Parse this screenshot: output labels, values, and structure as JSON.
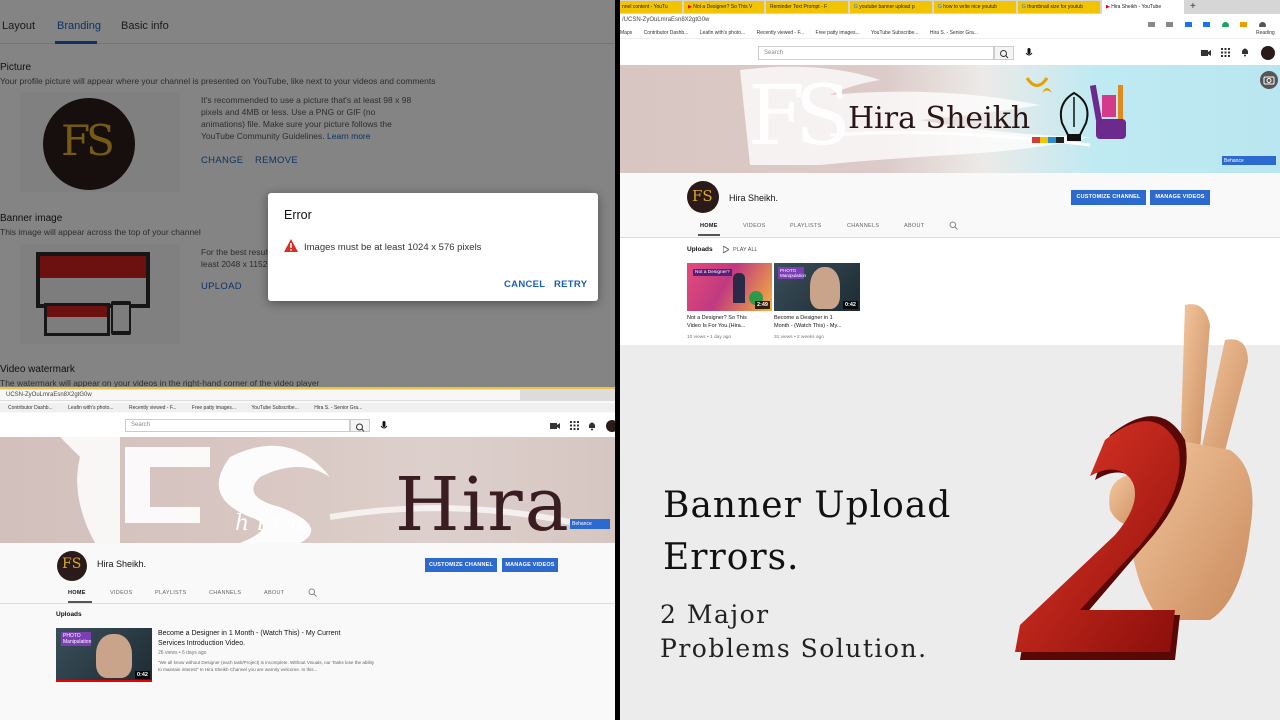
{
  "studio": {
    "tabs": [
      "Layout",
      "Branding",
      "Basic info"
    ],
    "picture": {
      "heading": "Picture",
      "subtitle": "Your profile picture will appear where your channel is presented on YouTube, like next to your videos and comments",
      "desc_line1": "It's recommended to use a picture that's at least 98 x 98",
      "desc_line2": "pixels and 4MB or less. Use a PNG or GIF (no",
      "desc_line3": "animations) file. Make sure your picture follows the",
      "desc_line4": "YouTube Community Guidelines.",
      "learn_more": "Learn more",
      "change": "CHANGE",
      "remove": "REMOVE"
    },
    "banner": {
      "heading": "Banner image",
      "subtitle": "This image will appear across the top of your channel",
      "desc_line1": "For the best results",
      "desc_line2": "least 2048 x 1152",
      "upload": "UPLOAD"
    },
    "watermark": {
      "heading": "Video watermark",
      "subtitle": "The watermark will appear on your videos in the right-hand corner of the video player"
    },
    "error": {
      "title": "Error",
      "message": "Images must be at least 1024 x 576 pixels",
      "cancel": "CANCEL",
      "retry": "RETRY"
    }
  },
  "browser_right": {
    "tabs": [
      "nnel content - YouTu",
      "Not a Designer? So This V",
      "Reminder Text Prompt - F",
      "youtube banner upload p",
      "how to write nice youtub",
      "thumbnail size for youtub",
      "Hira Sheikh - YouTube"
    ],
    "new_tab": "+",
    "address": "/UCSN-ZyOuLmraEsn8X2gtG0w",
    "bookmarks": [
      "Maps",
      "Contributor Dashb...",
      "Leafin with's photo...",
      "Recently viewed - F...",
      "Free patty images...",
      "YouTube Subscribe...",
      "Hira S. - Senior Gra..."
    ],
    "reading": "Reading"
  },
  "browser_left": {
    "address": "UCSN-ZyOuLmraEsn8X2gtG0w",
    "bookmarks": [
      "Contributor Dashb...",
      "Leafin with's photo...",
      "Recently viewed - F...",
      "Free patty images...",
      "YouTube Subscribe...",
      "Hira S. - Senior Gra..."
    ]
  },
  "channel": {
    "search_placeholder": "Search",
    "name": "Hira Sheikh.",
    "banner_name": "Hira Sheikh",
    "banner_name_zoomed": "Hira",
    "banner_script": "hira",
    "behance": "Behance",
    "customize": "CUSTOMIZE CHANNEL",
    "manage": "MANAGE VIDEOS",
    "nav": [
      "HOME",
      "VIDEOS",
      "PLAYLISTS",
      "CHANNELS",
      "ABOUT"
    ],
    "uploads_label": "Uploads",
    "play_all": "PLAY ALL",
    "videos": [
      {
        "title_l1": "Not a Designer? So This",
        "title_l2": "Video Is For You.(Hira...",
        "meta": "10 views • 1 day ago",
        "duration": "2:49"
      },
      {
        "title_l1": "Become a Designer in 1",
        "title_l2": "Month - (Watch This) - My...",
        "meta": "31 views • 2 weeks ago",
        "duration": "0:42"
      }
    ],
    "list_video": {
      "title_l1": "Become a Designer in 1 Month - (Watch This) - My Current",
      "title_l2": "Services Introduction Video.",
      "meta": "26 views • 6 days ago",
      "desc_l1": "\"We all know without Designer (each task/Project) is incomplete. Without Visuals, our Tasks lose the ability",
      "desc_l2": "to maintain interest\" In Hira Sheikh Channel you are warmly welcome. In this...",
      "duration": "0:42"
    },
    "thumb_label_1": "Not a Designer?",
    "thumb_label_2": "PHOTO Manipulation"
  },
  "overlay": {
    "title_line1": "Banner Upload",
    "title_line2": "Errors.",
    "subtitle_line1": "2 Major",
    "subtitle_line2": "Problems Solution.",
    "big_number": "2"
  },
  "colors": {
    "accent_blue": "#2d6ad0",
    "link_blue": "#1a5fb4",
    "error_red": "#d93025",
    "number_red": "#c8201a"
  }
}
